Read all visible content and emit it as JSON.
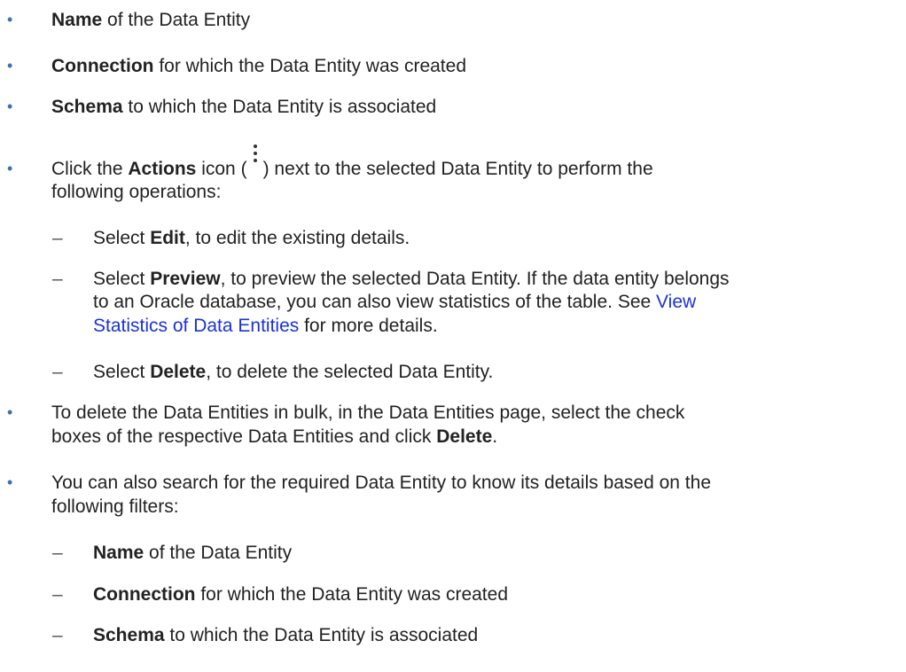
{
  "items": {
    "name_item": {
      "bold": "Name",
      "rest": " of the Data Entity"
    },
    "connection_item": {
      "bold": "Connection",
      "rest": " for which the Data Entity was created"
    },
    "schema_item": {
      "bold": "Schema",
      "rest": " to which the Data Entity is associated"
    },
    "actions_item": {
      "prefix": "Click the ",
      "bold": "Actions",
      "mid": " icon (",
      "after_icon": ") next to the selected Data Entity to perform the",
      "line2": "following operations:",
      "icon_name": "vertical-ellipsis-icon"
    },
    "edit_item": {
      "prefix": "Select ",
      "bold": "Edit",
      "rest": ", to edit the existing details."
    },
    "preview_item": {
      "prefix": "Select ",
      "bold": "Preview",
      "rest": ", to preview the selected Data Entity. If the data entity belongs",
      "line2": "to an Oracle database, you can also view statistics of the table. See ",
      "link_part1": "View",
      "link_part2": "Statistics of Data Entities",
      "line3_rest": " for more details."
    },
    "delete_item": {
      "prefix": "Select ",
      "bold": "Delete",
      "rest": ", to delete the selected Data Entity."
    },
    "bulk_delete_item": {
      "line1": "To delete the Data Entities in bulk, in the Data Entities page, select the check",
      "line2_prefix": "boxes of the respective Data Entities and click ",
      "bold": "Delete",
      "line2_suffix": "."
    },
    "search_item": {
      "line1": "You can also search for the required Data Entity to know its details based on the",
      "line2": "following filters:"
    },
    "filter_name": {
      "bold": "Name",
      "rest": " of the Data Entity"
    },
    "filter_connection": {
      "bold": "Connection",
      "rest": " for which the Data Entity was created"
    },
    "filter_schema": {
      "bold": "Schema",
      "rest": " to which the Data Entity is associated"
    }
  },
  "markers": {
    "bullet": "•",
    "dash": "–"
  },
  "colors": {
    "bullet": "#3c6fb5",
    "link": "#1a33d6",
    "text": "#222222"
  }
}
